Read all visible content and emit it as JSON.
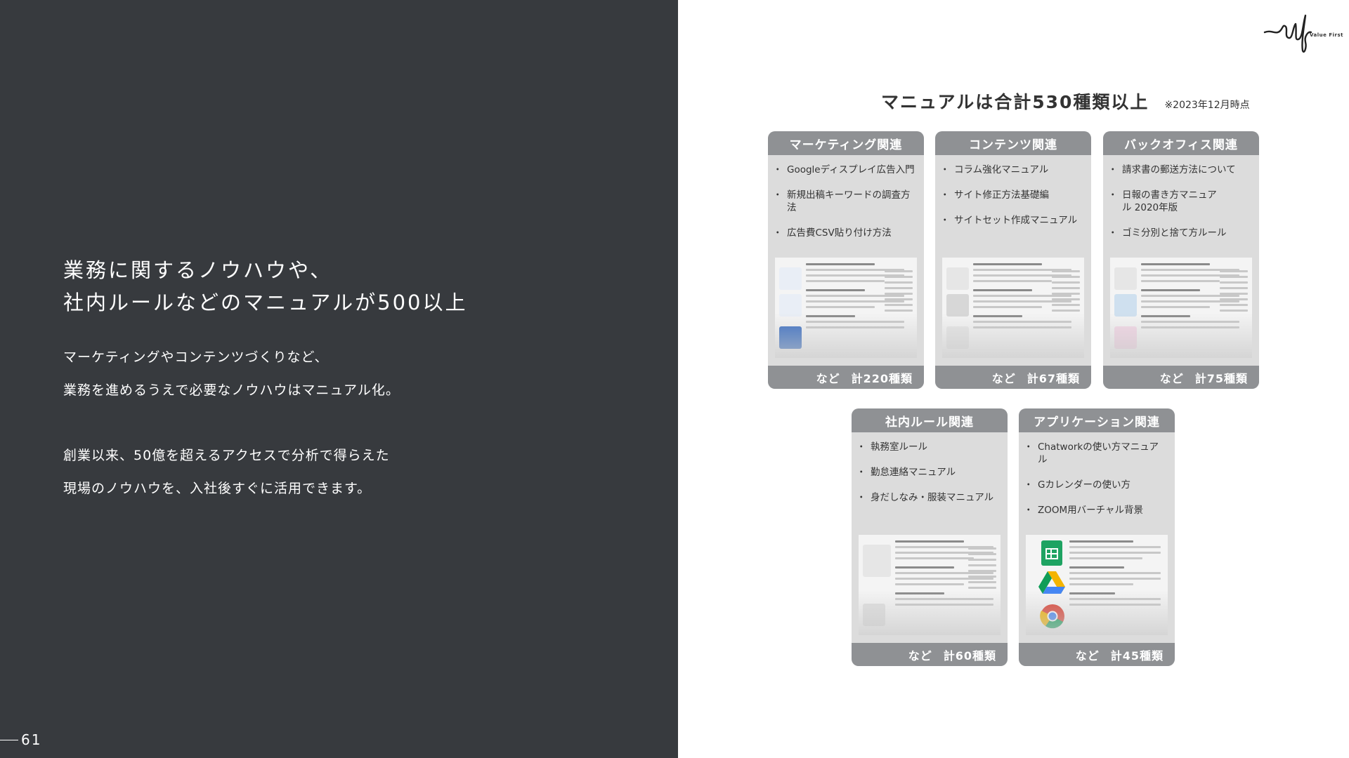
{
  "left": {
    "headline_line1": "業務に関するノウハウや、",
    "headline_line2": "社内ルールなどのマニュアルが500以上",
    "body1_line1": "マーケティングやコンテンツづくりなど、",
    "body1_line2": "業務を進めるうえで必要なノウハウはマニュアル化。",
    "body2_line1": "創業以来、50億を超えるアクセスで分析で得らえた",
    "body2_line2": "現場のノウハウを、入社後すぐに活用できます。",
    "page_number": "61"
  },
  "logo": {
    "text": "Value First",
    "icon": "value-first-signature-logo"
  },
  "summary": {
    "title": "マニュアルは合計530種類以上",
    "note": "※2023年12月時点"
  },
  "cards": [
    {
      "header": "マーケティング関連",
      "items": [
        "Googleディスプレイ広告入門",
        "新規出稿キーワードの調査方法",
        "広告費CSV貼り付け方法"
      ],
      "footer_suffix": "など",
      "footer_total": "計220種類"
    },
    {
      "header": "コンテンツ関連",
      "items": [
        "コラム強化マニュアル",
        "サイト修正方法基礎編",
        "サイトセット作成マニュアル"
      ],
      "footer_suffix": "など",
      "footer_total": "計67種類"
    },
    {
      "header": "バックオフィス関連",
      "items": [
        "請求書の郵送方法について",
        "日報の書き方マニュアル 2020年版",
        "ゴミ分別と捨て方ルール"
      ],
      "footer_suffix": "など",
      "footer_total": "計75種類"
    },
    {
      "header": "社内ルール関連",
      "items": [
        "執務室ルール",
        "勤怠連絡マニュアル",
        "身だしなみ・服装マニュアル"
      ],
      "footer_suffix": "など",
      "footer_total": "計60種類"
    },
    {
      "header": "アプリケーション関連",
      "items": [
        "Chatworkの使い方マニュアル",
        "Gカレンダーの使い方",
        "ZOOM用バーチャル背景"
      ],
      "footer_suffix": "など",
      "footer_total": "計45種類"
    }
  ],
  "colors": {
    "left_panel": "#373a3e",
    "card_bg": "#dcdcdc",
    "card_header": "#8f9194"
  }
}
